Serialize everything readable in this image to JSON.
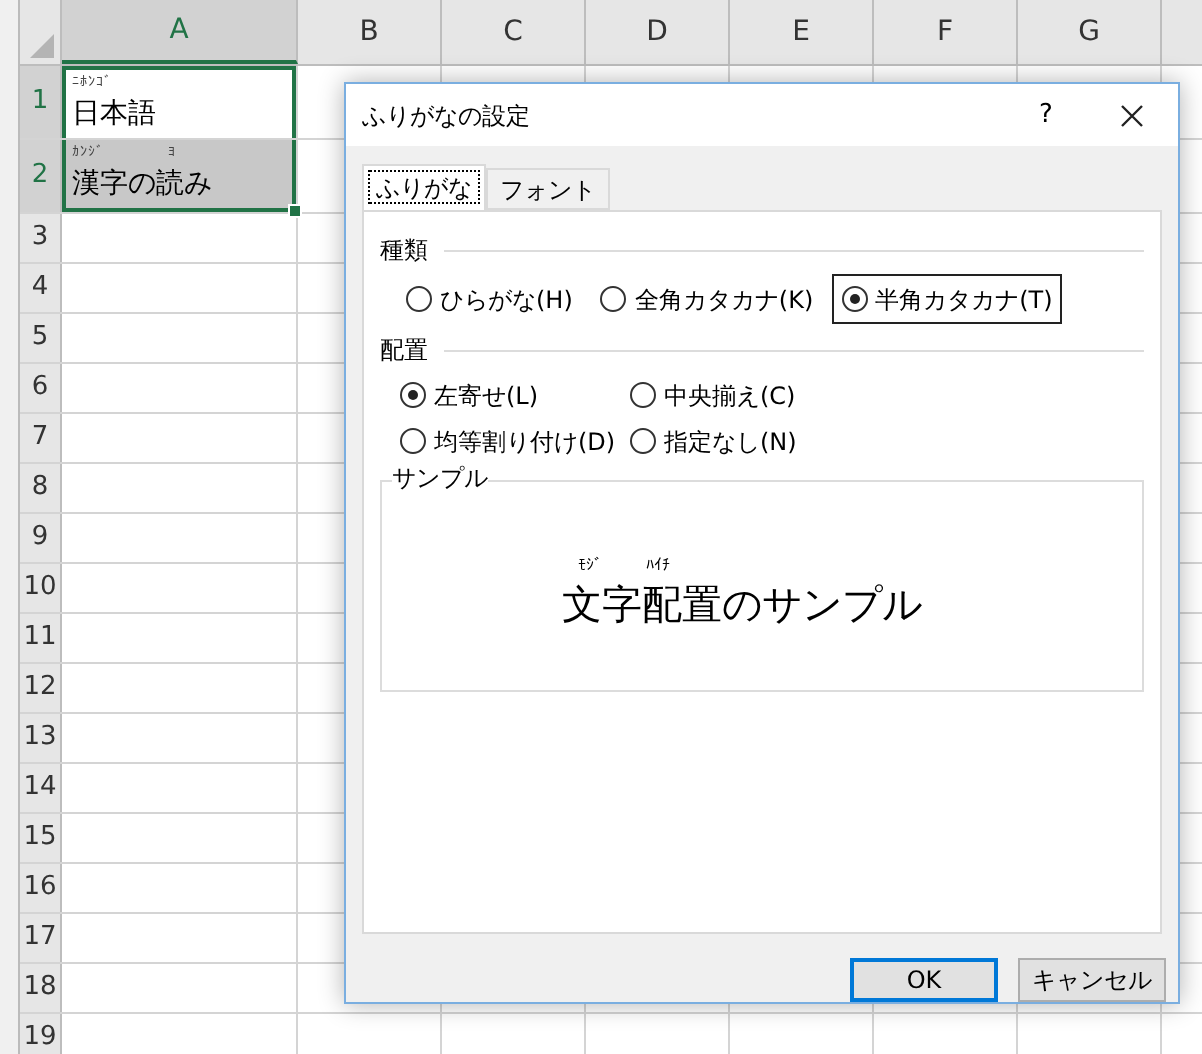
{
  "sheet": {
    "columns": [
      {
        "label": "A",
        "selected": true
      },
      {
        "label": "B",
        "selected": false
      },
      {
        "label": "C",
        "selected": false
      },
      {
        "label": "D",
        "selected": false
      },
      {
        "label": "E",
        "selected": false
      },
      {
        "label": "F",
        "selected": false
      },
      {
        "label": "G",
        "selected": false
      }
    ],
    "rows": [
      {
        "label": "1",
        "selected": true,
        "cell": {
          "text": "日本語",
          "furigana": [
            "ﾆﾎﾝｺﾞ"
          ],
          "shaded": false
        }
      },
      {
        "label": "2",
        "selected": true,
        "cell": {
          "text": "漢字の読み",
          "furigana": [
            "ｶﾝｼﾞ",
            "ﾖ"
          ],
          "shaded": true
        }
      },
      {
        "label": "3",
        "selected": false
      },
      {
        "label": "4",
        "selected": false
      },
      {
        "label": "5",
        "selected": false
      },
      {
        "label": "6",
        "selected": false
      },
      {
        "label": "7",
        "selected": false
      },
      {
        "label": "8",
        "selected": false
      },
      {
        "label": "9",
        "selected": false
      },
      {
        "label": "10",
        "selected": false
      },
      {
        "label": "11",
        "selected": false
      },
      {
        "label": "12",
        "selected": false
      },
      {
        "label": "13",
        "selected": false
      },
      {
        "label": "14",
        "selected": false
      },
      {
        "label": "15",
        "selected": false
      },
      {
        "label": "16",
        "selected": false
      },
      {
        "label": "17",
        "selected": false
      },
      {
        "label": "18",
        "selected": false
      },
      {
        "label": "19",
        "selected": false
      }
    ]
  },
  "dialog": {
    "title": "ふりがなの設定",
    "help": "?",
    "tabs": [
      {
        "label": "ふりがな",
        "selected": true
      },
      {
        "label": "フォント",
        "selected": false
      }
    ],
    "kind_group": {
      "title": "種類",
      "options": [
        {
          "label": "ひらがな(H)",
          "selected": false,
          "focused": false
        },
        {
          "label": "全角カタカナ(K)",
          "selected": false,
          "focused": false
        },
        {
          "label": "半角カタカナ(T)",
          "selected": true,
          "focused": true
        }
      ]
    },
    "align_group": {
      "title": "配置",
      "options": [
        {
          "label": "左寄せ(L)",
          "selected": true
        },
        {
          "label": "中央揃え(C)",
          "selected": false
        },
        {
          "label": "均等割り付け(D)",
          "selected": false
        },
        {
          "label": "指定なし(N)",
          "selected": false
        }
      ]
    },
    "sample": {
      "title": "サンプル",
      "text": "文字配置のサンプル",
      "furigana": [
        "ﾓｼﾞ",
        "ﾊｲﾁ"
      ]
    },
    "buttons": [
      {
        "label": "OK",
        "default": true
      },
      {
        "label": "キャンセル",
        "default": false
      }
    ]
  }
}
